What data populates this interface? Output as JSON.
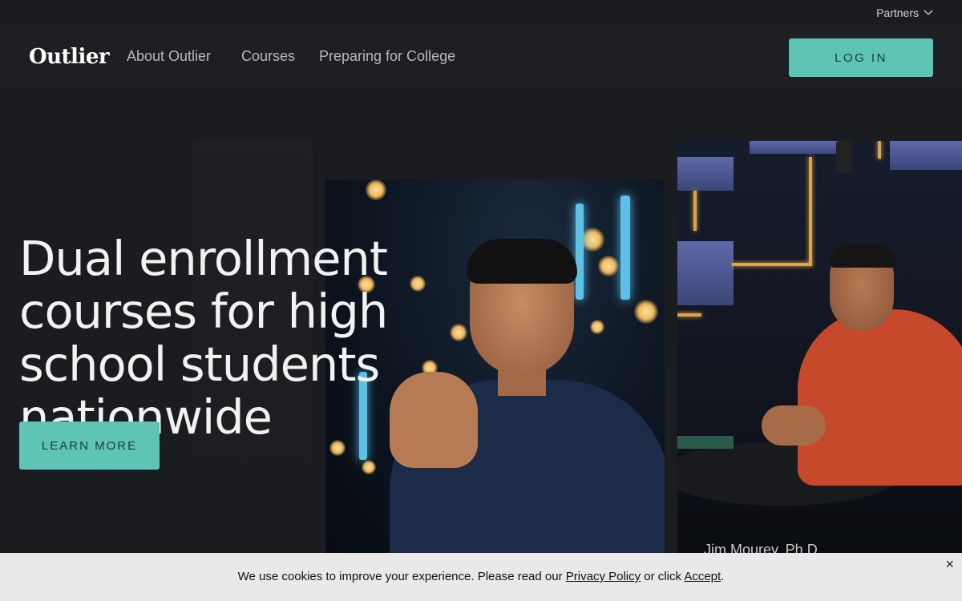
{
  "topbar": {
    "partners_label": "Partners"
  },
  "nav": {
    "logo": "Outlier",
    "links": [
      "About Outlier",
      "Courses",
      "Preparing for College"
    ],
    "login_label": "LOG IN"
  },
  "hero": {
    "headline": "Dual enrollment courses for high school students nationwide",
    "cta_label": "LEARN MORE",
    "photo_caption": "Jim Mourey, Ph.D."
  },
  "cookie_banner": {
    "text_before": "We use cookies to improve your experience. Please read our",
    "privacy_link": "Privacy Policy",
    "text_middle": "or click",
    "accept_link": "Accept",
    "text_after": ".",
    "close_symbol": "×"
  },
  "colors": {
    "accent": "#5ec4b6",
    "background": "#1b1c20",
    "cookie_bg": "#e9e9ea"
  }
}
